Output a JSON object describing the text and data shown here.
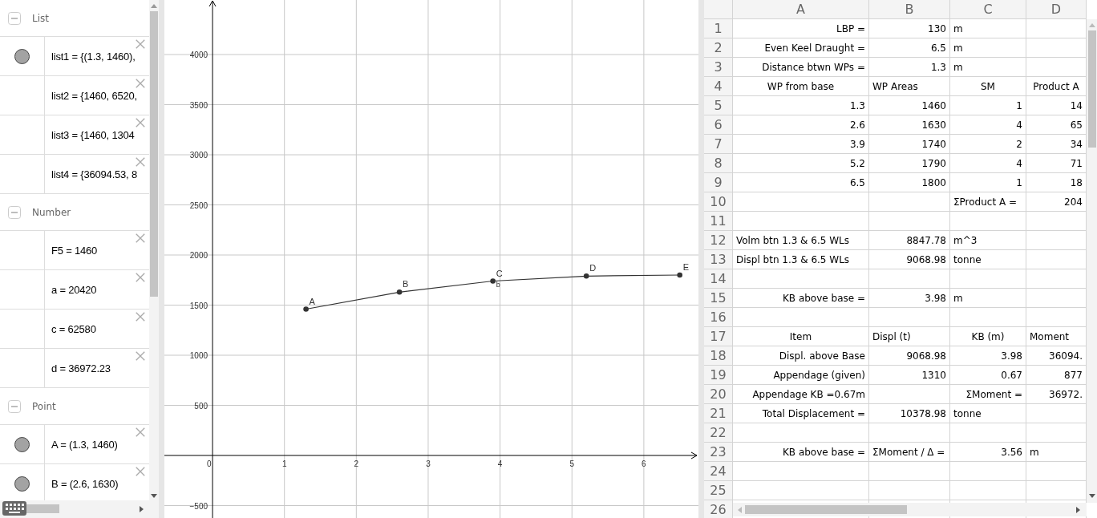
{
  "algebra": {
    "groups": [
      {
        "title": "List",
        "expanded": true,
        "items": [
          {
            "text": "list1 = {(1.3, 1460),",
            "visible": true
          },
          {
            "text": "list2 = {1460, 6520,",
            "visible": false
          },
          {
            "text": "list3 = {1460, 1304",
            "visible": false
          },
          {
            "text": "list4 = {36094.53, 8",
            "visible": false
          }
        ]
      },
      {
        "title": "Number",
        "expanded": true,
        "items": [
          {
            "text": "F5 = 1460",
            "visible": false
          },
          {
            "text": "a = 20420",
            "visible": false
          },
          {
            "text": "c = 62580",
            "visible": false
          },
          {
            "text": "d = 36972.23",
            "visible": false
          }
        ]
      },
      {
        "title": "Point",
        "expanded": true,
        "items": [
          {
            "text": "A = (1.3, 1460)",
            "visible": true
          },
          {
            "text": "B = (2.6, 1630)",
            "visible": true
          }
        ]
      }
    ]
  },
  "graphics": {
    "chart_data": {
      "type": "line",
      "x": [
        1.3,
        2.6,
        3.9,
        5.2,
        6.5
      ],
      "series": [
        {
          "color": "#333333",
          "marker": "circle",
          "values": [
            1460,
            1630,
            1740,
            1790,
            1800
          ]
        }
      ],
      "grid": true,
      "xlim": [
        -0.67,
        6.76
      ],
      "ylim": [
        -624,
        4544
      ],
      "xticks": [
        0,
        1,
        2,
        3,
        4,
        5,
        6
      ],
      "yticks": [
        -500,
        500,
        1000,
        1500,
        2000,
        2500,
        3000,
        3500,
        4000
      ],
      "annotations": [
        {
          "x": 1.3,
          "y": 1460,
          "text": "A"
        },
        {
          "x": 2.6,
          "y": 1630,
          "text": "B"
        },
        {
          "x": 3.9,
          "y": 1740,
          "text": "C"
        },
        {
          "x": 3.9,
          "y": 1740,
          "text": "b"
        },
        {
          "x": 5.2,
          "y": 1790,
          "text": "D"
        },
        {
          "x": 6.5,
          "y": 1800,
          "text": "E"
        }
      ]
    }
  },
  "spreadsheet": {
    "columns": [
      "A",
      "B",
      "C",
      "D"
    ],
    "rows": [
      {
        "number": "1",
        "cells": [
          {
            "text": "LBP =",
            "kind": "label"
          },
          {
            "text": "130",
            "kind": "number"
          },
          {
            "text": "m",
            "kind": "text"
          },
          null
        ]
      },
      {
        "number": "2",
        "cells": [
          {
            "text": "Even Keel Draught =",
            "kind": "label"
          },
          {
            "text": "6.5",
            "kind": "number"
          },
          {
            "text": "m",
            "kind": "text"
          },
          null
        ]
      },
      {
        "number": "3",
        "cells": [
          {
            "text": "Distance btwn WPs =",
            "kind": "label"
          },
          {
            "text": "1.3",
            "kind": "number"
          },
          {
            "text": "m",
            "kind": "text"
          },
          null
        ]
      },
      {
        "number": "4",
        "cells": [
          {
            "text": "WP from base",
            "kind": "heading"
          },
          {
            "text": "WP Areas",
            "kind": "text"
          },
          {
            "text": "SM",
            "kind": "heading"
          },
          {
            "text": "Product A",
            "kind": "heading"
          }
        ]
      },
      {
        "number": "5",
        "cells": [
          {
            "text": "1.3",
            "kind": "number"
          },
          {
            "text": "1460",
            "kind": "number"
          },
          {
            "text": "1",
            "kind": "number"
          },
          {
            "text": "14",
            "kind": "number"
          }
        ]
      },
      {
        "number": "6",
        "cells": [
          {
            "text": "2.6",
            "kind": "number"
          },
          {
            "text": "1630",
            "kind": "number"
          },
          {
            "text": "4",
            "kind": "number"
          },
          {
            "text": "65",
            "kind": "number"
          }
        ]
      },
      {
        "number": "7",
        "cells": [
          {
            "text": "3.9",
            "kind": "number"
          },
          {
            "text": "1740",
            "kind": "number"
          },
          {
            "text": "2",
            "kind": "number"
          },
          {
            "text": "34",
            "kind": "number"
          }
        ]
      },
      {
        "number": "8",
        "cells": [
          {
            "text": "5.2",
            "kind": "number"
          },
          {
            "text": "1790",
            "kind": "number"
          },
          {
            "text": "4",
            "kind": "number"
          },
          {
            "text": "71",
            "kind": "number"
          }
        ]
      },
      {
        "number": "9",
        "cells": [
          {
            "text": "6.5",
            "kind": "number"
          },
          {
            "text": "1800",
            "kind": "number"
          },
          {
            "text": "1",
            "kind": "number"
          },
          {
            "text": "18",
            "kind": "number"
          }
        ]
      },
      {
        "number": "10",
        "cells": [
          null,
          null,
          {
            "text": "ΣProduct A =",
            "kind": "text"
          },
          {
            "text": "204",
            "kind": "number"
          }
        ]
      },
      {
        "number": "11",
        "cells": [
          null,
          null,
          null,
          null
        ]
      },
      {
        "number": "12",
        "cells": [
          {
            "text": "Volm btn 1.3 & 6.5 WLs",
            "kind": "text"
          },
          {
            "text": "8847.78",
            "kind": "number"
          },
          {
            "text": "m^3",
            "kind": "text"
          },
          null
        ]
      },
      {
        "number": "13",
        "cells": [
          {
            "text": "Displ btn 1.3 & 6.5 WLs",
            "kind": "text"
          },
          {
            "text": "9068.98",
            "kind": "number"
          },
          {
            "text": "tonne",
            "kind": "text"
          },
          null
        ]
      },
      {
        "number": "14",
        "cells": [
          null,
          null,
          null,
          null
        ]
      },
      {
        "number": "15",
        "cells": [
          {
            "text": "KB above base =",
            "kind": "label"
          },
          {
            "text": "3.98",
            "kind": "number"
          },
          {
            "text": "m",
            "kind": "text"
          },
          null
        ]
      },
      {
        "number": "16",
        "cells": [
          null,
          null,
          null,
          null
        ]
      },
      {
        "number": "17",
        "cells": [
          {
            "text": "Item",
            "kind": "heading"
          },
          {
            "text": "Displ (t)",
            "kind": "text"
          },
          {
            "text": "KB (m)",
            "kind": "heading"
          },
          {
            "text": "Moment",
            "kind": "text"
          }
        ]
      },
      {
        "number": "18",
        "cells": [
          {
            "text": "Displ. above Base",
            "kind": "label"
          },
          {
            "text": "9068.98",
            "kind": "number"
          },
          {
            "text": "3.98",
            "kind": "number"
          },
          {
            "text": "36094.",
            "kind": "number"
          }
        ]
      },
      {
        "number": "19",
        "cells": [
          {
            "text": "Appendage (given)",
            "kind": "label"
          },
          {
            "text": "1310",
            "kind": "number"
          },
          {
            "text": "0.67",
            "kind": "number"
          },
          {
            "text": "877",
            "kind": "number"
          }
        ]
      },
      {
        "number": "20",
        "cells": [
          {
            "text": "Appendage KB =0.67m",
            "kind": "label"
          },
          null,
          {
            "text": "ΣMoment =",
            "kind": "label"
          },
          {
            "text": "36972.",
            "kind": "number"
          }
        ]
      },
      {
        "number": "21",
        "cells": [
          {
            "text": "Total Displacement =",
            "kind": "label"
          },
          {
            "text": "10378.98",
            "kind": "number"
          },
          {
            "text": "tonne",
            "kind": "text"
          },
          null
        ]
      },
      {
        "number": "22",
        "cells": [
          null,
          null,
          null,
          null
        ]
      },
      {
        "number": "23",
        "cells": [
          {
            "text": "KB above base =",
            "kind": "label"
          },
          {
            "text": "ΣMoment / Δ =",
            "kind": "text"
          },
          {
            "text": "3.56",
            "kind": "number"
          },
          {
            "text": "m",
            "kind": "text"
          }
        ]
      },
      {
        "number": "24",
        "cells": [
          null,
          null,
          null,
          null
        ]
      },
      {
        "number": "25",
        "cells": [
          null,
          null,
          null,
          null
        ]
      },
      {
        "number": "26",
        "cells": [
          null,
          null,
          null,
          null
        ]
      }
    ]
  }
}
